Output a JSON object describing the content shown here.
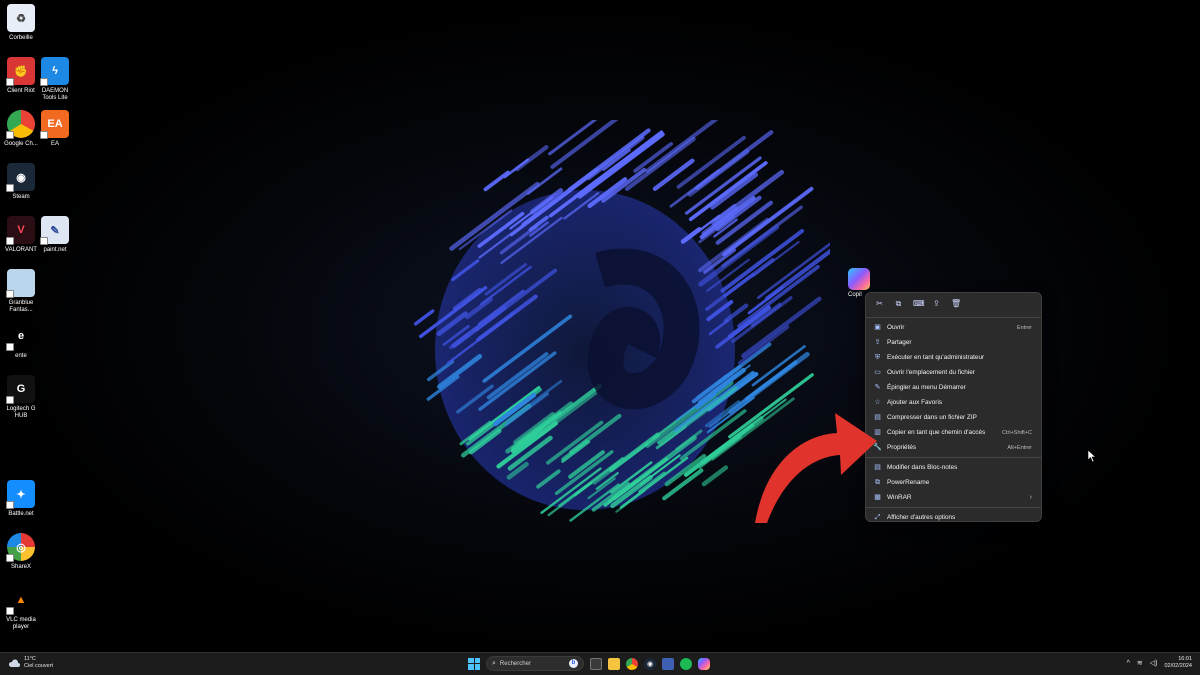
{
  "desktop": {
    "icons": [
      {
        "label": "Corbeille",
        "icon": "recycle-bin-icon"
      },
      {
        "label": "Client Riot",
        "icon": "riot-client-icon"
      },
      {
        "label": "DAEMON Tools Lite",
        "icon": "daemon-tools-icon"
      },
      {
        "label": "Google Ch...",
        "icon": "google-chrome-icon"
      },
      {
        "label": "EA",
        "icon": "ea-icon"
      },
      {
        "label": "Steam",
        "icon": "steam-icon"
      },
      {
        "label": "VALORANT",
        "icon": "valorant-icon"
      },
      {
        "label": "paint.net",
        "icon": "paint-net-icon"
      },
      {
        "label": "Granblue Fantas...",
        "icon": "granblue-fantasy-icon"
      },
      {
        "label": "ente",
        "icon": "ente-icon"
      },
      {
        "label": "Logitech G HUB",
        "icon": "logitech-g-hub-icon"
      },
      {
        "label": "Battle.net",
        "icon": "battle-net-icon"
      },
      {
        "label": "ShareX",
        "icon": "sharex-icon"
      },
      {
        "label": "VLC media player",
        "icon": "vlc-icon"
      }
    ],
    "selected_icon_label": "Copil",
    "selected_icon": "copilot-icon"
  },
  "context_menu": {
    "toolbar": [
      {
        "name": "cut",
        "glyph": "✂",
        "icon": "cut-icon"
      },
      {
        "name": "copy",
        "glyph": "⧉",
        "icon": "copy-icon"
      },
      {
        "name": "rename",
        "glyph": "⌨",
        "icon": "rename-icon"
      },
      {
        "name": "share",
        "glyph": "⇪",
        "icon": "share-icon"
      },
      {
        "name": "delete",
        "glyph": "🗑",
        "icon": "delete-icon"
      }
    ],
    "items": [
      {
        "label": "Ouvrir",
        "shortcut": "Entrer",
        "glyph": "▣",
        "icon": "open-icon"
      },
      {
        "label": "Partager",
        "shortcut": "",
        "glyph": "⇪",
        "icon": "share-icon"
      },
      {
        "label": "Exécuter en tant qu'administrateur",
        "shortcut": "",
        "glyph": "⛨",
        "icon": "admin-shield-icon"
      },
      {
        "label": "Ouvrir l'emplacement du fichier",
        "shortcut": "",
        "glyph": "▭",
        "icon": "folder-icon"
      },
      {
        "label": "Épingler au menu Démarrer",
        "shortcut": "",
        "glyph": "✎",
        "icon": "pin-icon"
      },
      {
        "label": "Ajouter aux Favoris",
        "shortcut": "",
        "glyph": "☆",
        "icon": "star-icon"
      },
      {
        "label": "Compresser dans un fichier ZIP",
        "shortcut": "",
        "glyph": "▤",
        "icon": "zip-icon"
      },
      {
        "label": "Copier en tant que chemin d'accès",
        "shortcut": "Ctrl+Shift+C",
        "glyph": "▥",
        "icon": "copy-path-icon"
      },
      {
        "label": "Propriétés",
        "shortcut": "Alt+Entrer",
        "glyph": "🔧",
        "icon": "properties-wrench-icon"
      }
    ],
    "extra_items": [
      {
        "label": "Modifier dans Bloc-notes",
        "glyph": "▤",
        "icon": "notepad-icon"
      },
      {
        "label": "PowerRename",
        "glyph": "⧉",
        "icon": "powerrename-icon"
      },
      {
        "label": "WinRAR",
        "glyph": "▦",
        "icon": "winrar-icon",
        "submenu": "›"
      }
    ],
    "more_options": {
      "label": "Afficher d'autres options",
      "glyph": "⤢",
      "icon": "more-options-icon"
    }
  },
  "taskbar": {
    "weather_temp": "11°C",
    "weather_desc": "Ciel couvert",
    "search_placeholder": "Rechercher",
    "search_badge": "b",
    "apps": [
      "task-view-icon",
      "file-explorer-icon",
      "chrome-taskbar-icon",
      "steam-taskbar-icon",
      "paint-net-taskbar-icon",
      "spotify-icon",
      "copilot-taskbar-icon"
    ],
    "tray_chevron": "^",
    "clock_time": "16:01",
    "clock_date": "02/02/2024"
  },
  "colors": {
    "accent_arrow": "#e0332b",
    "taskbar_bg": "#1c1c1c",
    "menu_bg": "#2b2b2b"
  }
}
